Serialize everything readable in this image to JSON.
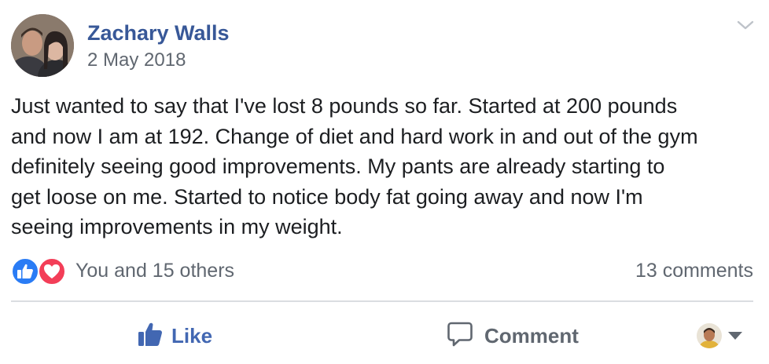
{
  "post": {
    "author": "Zachary Walls",
    "date": "2 May 2018",
    "message": "Just wanted to say that I've lost 8 pounds so far. Started at 200 pounds\nand now I am at 192. Change of diet and hard work in and out of the gym\ndefinitely seeing good improvements. My pants are already starting to\nget loose on me. Started to notice body fat going away and now I'm\nseeing improvements in my weight."
  },
  "reactions": {
    "icons": [
      "like-icon",
      "love-icon"
    ],
    "summary": "You and 15 others",
    "comments": "13 comments"
  },
  "actions": {
    "like_label": "Like",
    "comment_label": "Comment"
  },
  "icons": {
    "post_options": "chevron-down-icon",
    "like": "thumbs-up-icon",
    "comment": "speech-bubble-icon",
    "audience": "caret-down-icon"
  },
  "colors": {
    "author_link": "#385898",
    "like_blue": "#4267b2",
    "love_red": "#f33e58",
    "secondary_text": "#606770",
    "divider": "#dadde1"
  }
}
